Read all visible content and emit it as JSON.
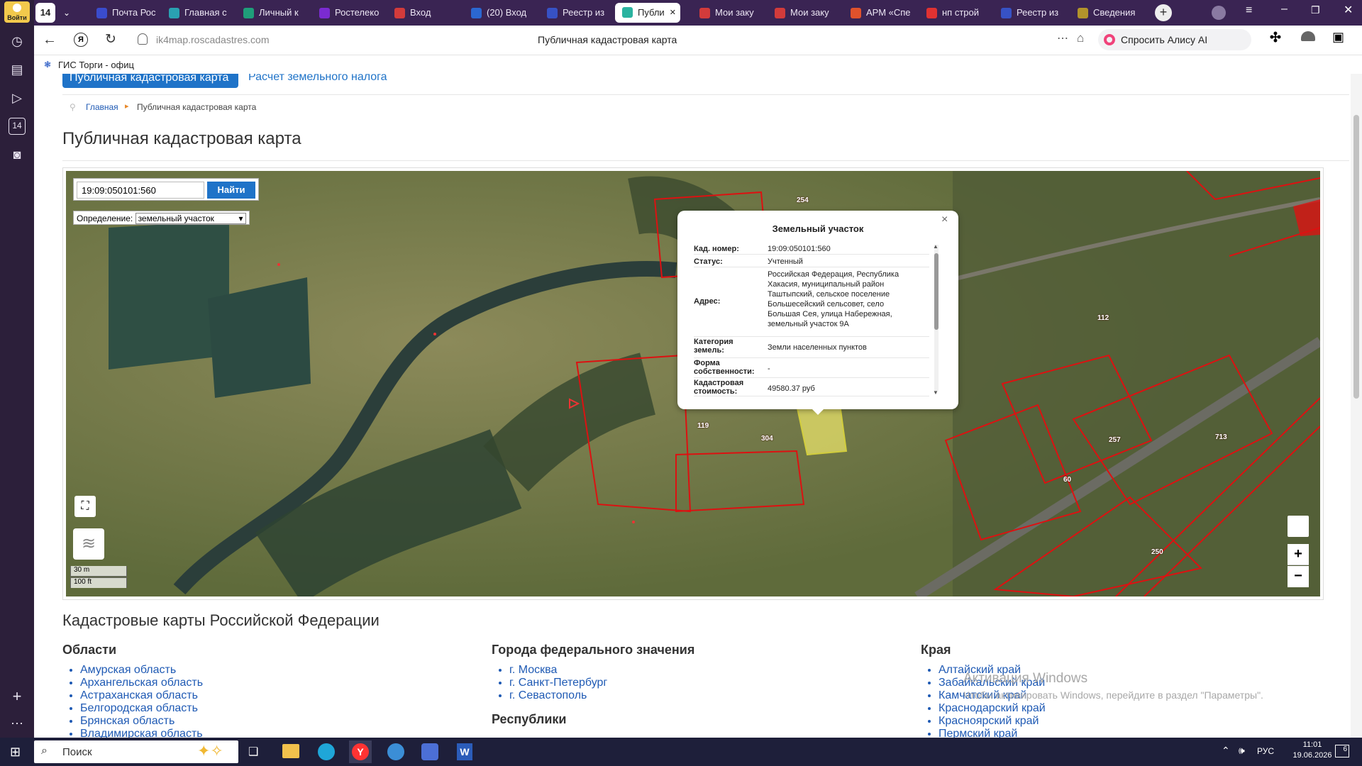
{
  "browser": {
    "login_label": "Войти",
    "tab_counter": "14",
    "tabs": [
      {
        "label": "Почта Рос",
        "color": "#3a4ccc"
      },
      {
        "label": "Главная с",
        "color": "#2aa1b2"
      },
      {
        "label": "Личный к",
        "color": "#1f9e7a"
      },
      {
        "label": "Ростелеко",
        "color": "#7b2bd1"
      },
      {
        "label": "Вход",
        "color": "#d23b3b"
      },
      {
        "label": "(20) Вход",
        "color": "#2b67d1"
      },
      {
        "label": "Реестр из",
        "color": "#3752c5"
      },
      {
        "label": "Публи",
        "color": "#2bb3a0"
      },
      {
        "label": "Мои заку",
        "color": "#d23b3b"
      },
      {
        "label": "Мои заку",
        "color": "#d23b3b"
      },
      {
        "label": "АРМ «Спе",
        "color": "#e0522c"
      },
      {
        "label": "нп строй",
        "color": "#e03232"
      },
      {
        "label": "Реестр из",
        "color": "#3752c5"
      },
      {
        "label": "Сведения",
        "color": "#b2932b"
      }
    ],
    "url": "ik4map.roscadastres.com",
    "page_title": "Публичная кадастровая карта",
    "alice_label": "Спросить Алису AI",
    "bookmark": "ГИС Торги - офиц"
  },
  "site": {
    "nav_active": "Публичная кадастровая карта",
    "nav_link": "Расчет земельного налога",
    "breadcrumb_home": "Главная",
    "breadcrumb_current": "Публичная кадастровая карта",
    "heading": "Публичная кадастровая карта"
  },
  "map": {
    "search_value": "19:09:050101:560",
    "search_button": "Найти",
    "definition_label": "Определение:",
    "definition_value": "земельный участок",
    "scale_m": "30 m",
    "scale_ft": "100 ft",
    "zoom_in": "+",
    "zoom_out": "−",
    "plot_labels": [
      "254",
      "112",
      "119",
      "304",
      "257",
      "60",
      "250",
      "713"
    ],
    "popup": {
      "title": "Земельный участок",
      "close": "×",
      "rows": [
        {
          "k": "Кад. номер:",
          "v": "19:09:050101:560"
        },
        {
          "k": "Статус:",
          "v": "Учтенный"
        },
        {
          "k": "Адрес:",
          "v": "Российская Федерация, Республика Хакасия, муниципальный район Таштыпский, сельское поселение Большесейский сельсовет, село Большая Сея, улица Набережная, земельный участок 9А"
        },
        {
          "k": "Категория земель:",
          "v": "Земли населенных пунктов"
        },
        {
          "k": "Форма собственности:",
          "v": "-"
        },
        {
          "k": "Кадастровая стоимость:",
          "v": "49580.37 руб"
        }
      ]
    }
  },
  "lists": {
    "section_title": "Кадастровые карты Российской Федерации",
    "oblasti_title": "Области",
    "oblasti": [
      "Амурская область",
      "Архангельская область",
      "Астраханская область",
      "Белгородская область",
      "Брянская область",
      "Владимирская область"
    ],
    "cities_title": "Города федерального значения",
    "cities": [
      "г. Москва",
      "г. Санкт-Петербург",
      "г. Севастополь"
    ],
    "republics_title": "Республики",
    "kraya_title": "Края",
    "kraya": [
      "Алтайский край",
      "Забайкальский край",
      "Камчатский край",
      "Краснодарский край",
      "Красноярский край",
      "Пермский край"
    ]
  },
  "watermark": {
    "line1": "Активация Windows",
    "line2": "Чтобы активировать Windows, перейдите в раздел \"Параметры\"."
  },
  "taskbar": {
    "search": "Поиск",
    "lang": "РУС",
    "time": "11:01",
    "date": "19.06.2026",
    "notif": "6"
  }
}
